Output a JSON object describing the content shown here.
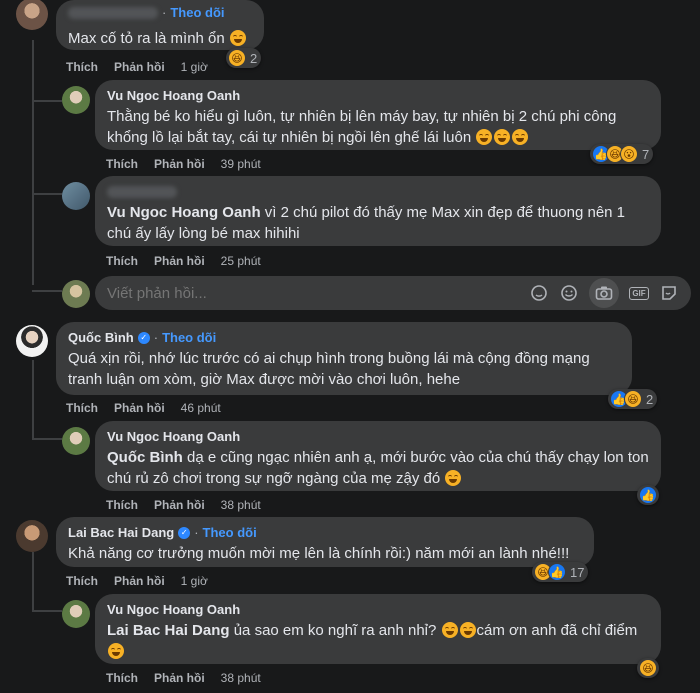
{
  "comments": {
    "c0": {
      "follow": "Theo dõi",
      "text": "Max cố tỏ ra là mình ổn",
      "actions": {
        "like": "Thích",
        "reply": "Phản hồi",
        "time": "1 giờ"
      },
      "reaction_count": "2"
    },
    "r1": {
      "name": "Vu Ngoc Hoang Oanh",
      "text": "Thằng bé ko hiểu gì luôn, tự nhiên bị lên máy bay, tự nhiên bị 2 chú phi công khổng lồ lại bắt tay, cái tự nhiên bị ngồi lên ghế lái luôn",
      "actions": {
        "like": "Thích",
        "reply": "Phản hồi",
        "time": "39 phút"
      },
      "reaction_count": "7"
    },
    "r2": {
      "mention": "Vu Ngoc Hoang Oanh",
      "text": " vì 2 chú pilot đó thấy mẹ Max xin đẹp để thuong nên 1 chú ấy lấy lòng bé max hihihi",
      "actions": {
        "like": "Thích",
        "reply": "Phản hồi",
        "time": "25 phút"
      }
    },
    "write_reply": {
      "placeholder": "Viết phản hồi..."
    },
    "c1": {
      "name": "Quốc Bình",
      "follow": "Theo dõi",
      "text": "Quá xịn rồi, nhớ lúc trước có ai chụp hình trong buồng lái mà cộng đồng mạng tranh luận om xòm, giờ Max được mời vào chơi luôn, hehe",
      "actions": {
        "like": "Thích",
        "reply": "Phản hồi",
        "time": "46 phút"
      },
      "reaction_count": "2"
    },
    "r3": {
      "name": "Vu Ngoc Hoang Oanh",
      "mention": "Quốc Bình",
      "text": " dạ e cũng ngạc nhiên anh ạ, mới bước vào của chú thấy chạy lon ton chú rủ zô chơi trong sự ngỡ ngàng của mẹ zậy đó",
      "actions": {
        "like": "Thích",
        "reply": "Phản hồi",
        "time": "38 phút"
      }
    },
    "c2": {
      "name": "Lai Bac Hai Dang",
      "follow": "Theo dõi",
      "text": "Khả năng cơ trưởng muốn mời mẹ lên là chính rồi:) năm mới an lành nhé!!!",
      "actions": {
        "like": "Thích",
        "reply": "Phản hồi",
        "time": "1 giờ"
      },
      "reaction_count": "17"
    },
    "r4": {
      "name": "Vu Ngoc Hoang Oanh",
      "mention": "Lai Bac Hai Dang",
      "text": " ủa sao em ko nghĩ ra anh nhỉ?",
      "text2": "cám ơn anh đã chỉ điểm",
      "actions": {
        "like": "Thích",
        "reply": "Phản hồi",
        "time": "38 phút"
      }
    }
  },
  "colors": {
    "background": "#18191a",
    "bubble": "#3a3b3c",
    "follow_link": "#4599ff",
    "like_blue": "#1877f2",
    "haha_yellow": "#f7b125"
  },
  "icons": [
    "verified-badge-icon",
    "like-reaction-icon",
    "haha-reaction-icon",
    "sticker-icon",
    "emoji-icon",
    "camera-icon",
    "gif-icon",
    "gift-sticker-icon"
  ]
}
